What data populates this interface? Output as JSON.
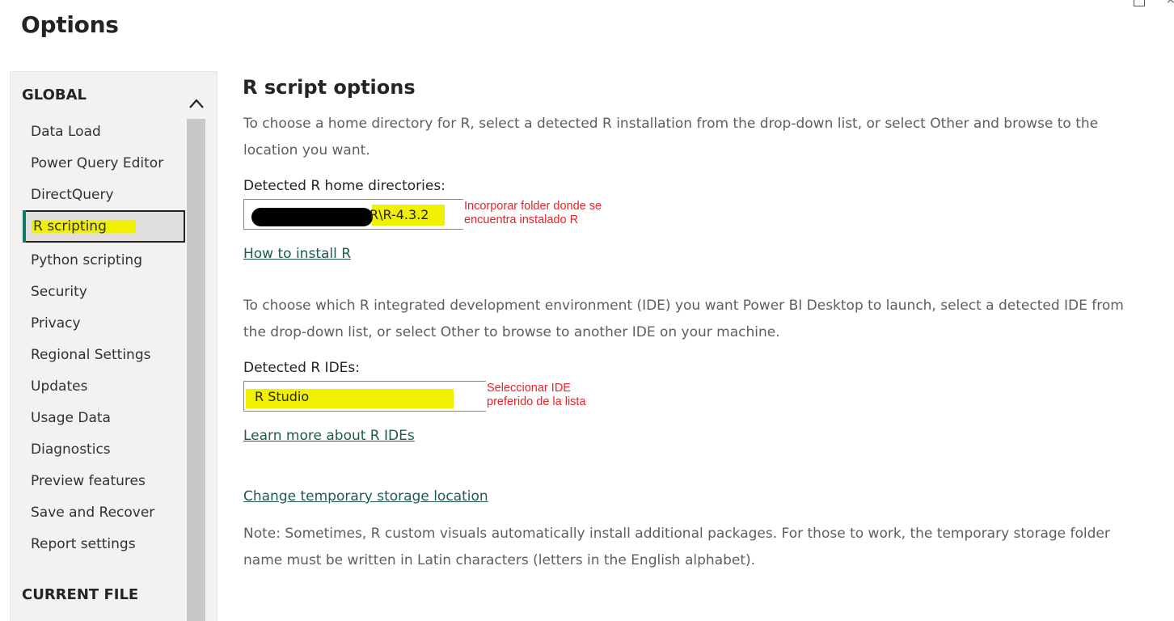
{
  "window": {
    "title": "Options",
    "close_glyph": "×"
  },
  "sidebar": {
    "global_header": "GLOBAL",
    "current_file_header": "CURRENT FILE",
    "items": [
      {
        "label": "Data Load"
      },
      {
        "label": "Power Query Editor"
      },
      {
        "label": "DirectQuery"
      },
      {
        "label": "R scripting",
        "selected": true
      },
      {
        "label": "Python scripting"
      },
      {
        "label": "Security"
      },
      {
        "label": "Privacy"
      },
      {
        "label": "Regional Settings"
      },
      {
        "label": "Updates"
      },
      {
        "label": "Usage Data"
      },
      {
        "label": "Diagnostics"
      },
      {
        "label": "Preview features"
      },
      {
        "label": "Save and Recover"
      },
      {
        "label": "Report settings"
      }
    ],
    "scroll_icon": "chevron-up-icon"
  },
  "main": {
    "title": "R script options",
    "home_description": "To choose a home directory for R, select a detected R installation from the drop-down list, or select Other and browse to the location you want.",
    "home_label": "Detected R home directories:",
    "home_value": "R\\R-4.3.2",
    "home_annotation": "Incorporar folder donde se\nencuentra instalado R",
    "install_link": "How to install R",
    "ide_description": "To choose which R integrated development environment (IDE) you want Power BI Desktop to launch, select a detected IDE from the drop-down list, or select Other to browse to another IDE on your machine.",
    "ide_label": "Detected R IDEs:",
    "ide_value": "R Studio",
    "ide_annotation": "Seleccionar IDE\npreferido de la lista",
    "ide_link": "Learn more about R IDEs",
    "storage_link": "Change temporary storage location",
    "note": "Note: Sometimes, R custom visuals automatically install additional packages. For those to work, the temporary storage folder name must be written in Latin characters (letters in the English alphabet)."
  },
  "colors": {
    "highlight": "#f1f000",
    "annotation": "#e8232a",
    "link": "#1e5a4f",
    "selected_accent": "#117865"
  }
}
